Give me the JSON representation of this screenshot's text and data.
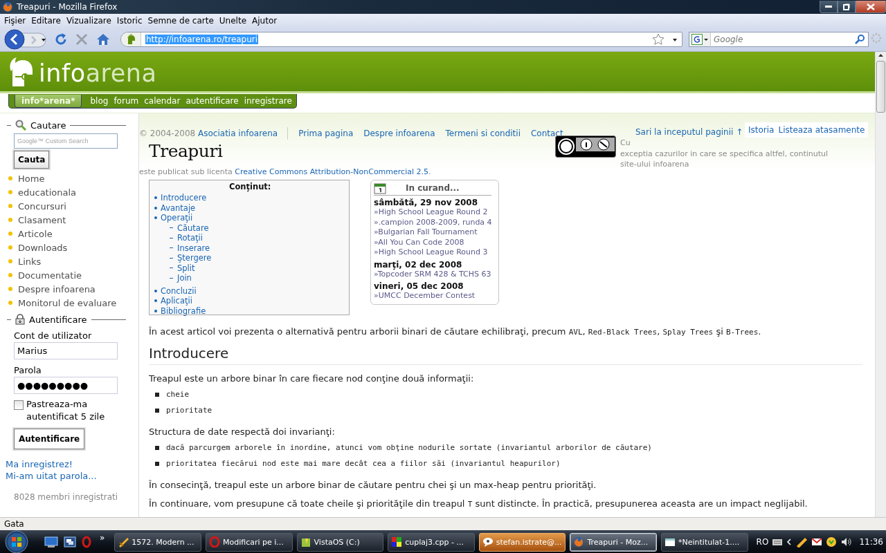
{
  "window": {
    "title": "Treapuri - Mozilla Firefox"
  },
  "menu": [
    "Fişier",
    "Editare",
    "Vizualizare",
    "Istoric",
    "Semne de carte",
    "Unelte",
    "Ajutor"
  ],
  "navbar": {
    "url": "http://infoarena.ro/treapuri",
    "url_selected": true,
    "search_placeholder": "Google"
  },
  "site": {
    "logo_first": "info",
    "logo_second": "arena",
    "tabs": [
      {
        "label": "info*arena*",
        "selected": true
      },
      {
        "label": "blog",
        "selected": false
      },
      {
        "label": "forum",
        "selected": false
      },
      {
        "label": "calendar",
        "selected": false
      },
      {
        "label": "autentificare",
        "selected": false
      },
      {
        "label": "inregistrare",
        "selected": false
      }
    ]
  },
  "sidebar": {
    "search": {
      "legend": "Cautare",
      "placeholder": "Google™ Custom Search",
      "button": "Cauta"
    },
    "nav": [
      "Home",
      "educationala",
      "Concursuri",
      "Clasament",
      "Articole",
      "Downloads",
      "Links",
      "Documentatie",
      "Despre infoarena",
      "Monitorul de evaluare"
    ],
    "auth": {
      "legend": "Autentificare",
      "user_label": "Cont de utilizator",
      "user_value": "Marius",
      "pass_label": "Parola",
      "pass_value": "●●●●●●●●●",
      "remember": {
        "label": "Pastreaza-ma autentificat 5 zile",
        "checked": false
      },
      "button": "Autentificare",
      "links": [
        "Ma inregistrez!",
        "Mi-am uitat parola..."
      ],
      "members": "8028 membri inregistrati"
    }
  },
  "footer": {
    "copyright": "© 2004-2008",
    "org_link": "Asociatia infoarena",
    "links": [
      "Prima pagina",
      "Despre infoarena",
      "Termeni si conditii",
      "Contact"
    ],
    "top_link": "Sari la inceputul paginii ↑",
    "license_lines": [
      "Cu",
      "exceptia cazurilor in care se specifica altfel, continutul",
      "site-ului infoarena"
    ],
    "license_tail": "este publicat sub licenta",
    "license_link": "Creative Commons Attribution-NonCommercial 2.5",
    "license_end": "."
  },
  "page_actions": [
    "Istoria",
    "Listeaza atasamente"
  ],
  "title": "Treapuri",
  "toc": {
    "title": "Conţinut:",
    "items": [
      {
        "label": "Introducere"
      },
      {
        "label": "Avantaje"
      },
      {
        "label": "Operaţii",
        "children": [
          {
            "label": "Căutare"
          },
          {
            "label": "Rotaţii"
          },
          {
            "label": "Inserare"
          },
          {
            "label": "Ştergere"
          },
          {
            "label": "Split"
          },
          {
            "label": "Join"
          }
        ]
      },
      {
        "label": "Concluzii"
      },
      {
        "label": "Aplicaţii"
      },
      {
        "label": "Bibliografie"
      }
    ]
  },
  "calendar": {
    "title": "In curand...",
    "days": [
      {
        "date": "sâmbătă, 29 nov 2008",
        "events": [
          "»High School League Round 2",
          "».campion 2008-2009, runda 4",
          "»Bulgarian Fall Tournament",
          "»All You Can Code 2008",
          "»High School League Round 3"
        ]
      },
      {
        "date": "marţi, 02 dec 2008",
        "events": [
          "»Topcoder SRM 428 & TCHS 63"
        ]
      },
      {
        "date": "vineri, 05 dec 2008",
        "events": [
          "»UMCC December Contest"
        ]
      }
    ]
  },
  "article": [
    {
      "kind": "paragraph",
      "parts": [
        {
          "kind": "text",
          "text": "În acest articol voi prezenta o alternativă pentru arborii binari de căutare echilibraţi, precum "
        },
        {
          "kind": "code",
          "text": "AVL"
        },
        {
          "kind": "text",
          "text": ", "
        },
        {
          "kind": "code",
          "text": "Red-Black Trees"
        },
        {
          "kind": "text",
          "text": ", "
        },
        {
          "kind": "code",
          "text": "Splay Trees"
        },
        {
          "kind": "text",
          "text": " şi "
        },
        {
          "kind": "code",
          "text": "B-Trees"
        },
        {
          "kind": "text",
          "text": "."
        }
      ]
    },
    {
      "kind": "heading",
      "text": "Introducere"
    },
    {
      "kind": "paragraph",
      "parts": [
        {
          "kind": "text",
          "text": "Treapul este un arbore binar în care fiecare nod conţine două informaţii:"
        }
      ]
    },
    {
      "kind": "code_list",
      "items": [
        "cheie",
        "prioritate"
      ]
    },
    {
      "kind": "paragraph",
      "parts": [
        {
          "kind": "text",
          "text": "Structura de date respectă doi invarianţi:"
        }
      ]
    },
    {
      "kind": "code_list",
      "items": [
        "dacă parcurgem arborele în inordine, atunci vom obţine nodurile sortate (invariantul arborilor de căutare)",
        "prioritatea fiecărui nod este mai mare decât cea a fiilor săi (invariantul heapurilor)"
      ]
    },
    {
      "kind": "paragraph",
      "parts": [
        {
          "kind": "text",
          "text": "În consecinţă, treapul este un arbore binar de căutare pentru chei şi un max-heap pentru priorităţi."
        }
      ]
    },
    {
      "kind": "paragraph",
      "parts": [
        {
          "kind": "text",
          "text": "În continuare, vom presupune că toate cheile şi priorităţile din treapul "
        },
        {
          "kind": "code",
          "text": "T"
        },
        {
          "kind": "text",
          "text": " sunt distincte. În practică, presupunerea aceasta are un impact neglijabil."
        }
      ]
    }
  ],
  "status_bar": {
    "text": "Gata"
  },
  "taskbar": {
    "overflow": "»",
    "tasks": [
      {
        "label": "1572. Modern ...",
        "kind": "app",
        "selected": false,
        "attention": false
      },
      {
        "label": "Modificari pe i...",
        "kind": "opera",
        "selected": false,
        "attention": false
      },
      {
        "label": "VistaOS (C:)",
        "kind": "folder",
        "selected": false,
        "attention": false
      },
      {
        "label": "cuplaj3.cpp - ...",
        "kind": "editor",
        "selected": false,
        "attention": false
      },
      {
        "label": "stefan.istrate@...",
        "kind": "chat",
        "selected": false,
        "attention": true
      },
      {
        "label": "Treapuri - Moz...",
        "kind": "firefox",
        "selected": true,
        "attention": false
      },
      {
        "label": "*Neintitulat-1....",
        "kind": "paint",
        "selected": false,
        "attention": false
      }
    ],
    "language": "RO",
    "clock": "11:36"
  }
}
